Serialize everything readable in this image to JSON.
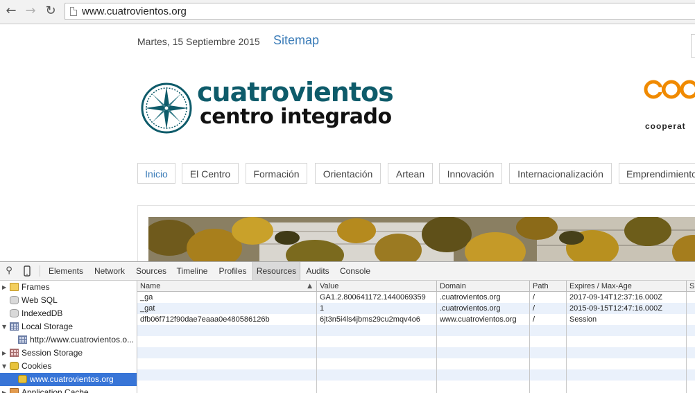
{
  "browser": {
    "url": "www.cuatrovientos.org",
    "back_icon": "back-arrow-icon",
    "forward_icon": "forward-arrow-icon",
    "reload_icon": "reload-icon"
  },
  "page": {
    "date": "Martes, 15 Septiembre 2015",
    "sitemap": "Sitemap",
    "logo": {
      "line1": "cuatrovientos",
      "line2": "centro integrado",
      "brand_color": "#0e5b6a"
    },
    "partner": {
      "visible_text": "cooperat",
      "accent_color": "#f08a00"
    },
    "menu": [
      "Inicio",
      "El Centro",
      "Formación",
      "Orientación",
      "Artean",
      "Innovación",
      "Internacionalización",
      "Emprendimiento"
    ]
  },
  "devtools": {
    "tabs": [
      "Elements",
      "Network",
      "Sources",
      "Timeline",
      "Profiles",
      "Resources",
      "Audits",
      "Console"
    ],
    "active_tab": "Resources",
    "tree": [
      {
        "label": "Frames",
        "icon": "folder-icon"
      },
      {
        "label": "Web SQL",
        "icon": "database-icon"
      },
      {
        "label": "IndexedDB",
        "icon": "database-icon"
      },
      {
        "label": "Local Storage",
        "icon": "storage-grid-icon"
      },
      {
        "label": "http://www.cuatrovientos.o...",
        "icon": "storage-grid-icon"
      },
      {
        "label": "Session Storage",
        "icon": "storage-grid-icon"
      },
      {
        "label": "Cookies",
        "icon": "cookie-icon"
      },
      {
        "label": "www.cuatrovientos.org",
        "icon": "cookie-icon"
      },
      {
        "label": "Application Cache",
        "icon": "appcache-icon"
      }
    ],
    "cookie_table": {
      "columns": [
        "Name",
        "Value",
        "Domain",
        "Path",
        "Expires / Max-Age",
        "Si"
      ],
      "rows": [
        [
          "_ga",
          "GA1.2.800641172.1440069359",
          ".cuatrovientos.org",
          "/",
          "2017-09-14T12:37:16.000Z"
        ],
        [
          "_gat",
          "1",
          ".cuatrovientos.org",
          "/",
          "2015-09-15T12:47:16.000Z"
        ],
        [
          "dfb06f712f90dae7eaaa0e480586126b",
          "6jt3n5i4ls4jbms29cu2mqv4o6",
          "www.cuatrovientos.org",
          "/",
          "Session"
        ]
      ]
    }
  }
}
